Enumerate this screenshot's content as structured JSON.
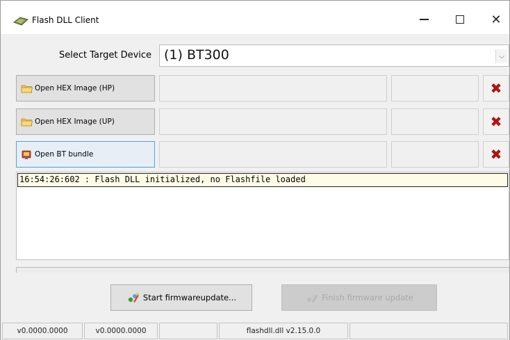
{
  "window": {
    "title": "Flash DLL Client",
    "icon": "flash-chip-icon",
    "controls": {
      "minimize_icon": "minimize-icon",
      "maximize_icon": "maximize-icon",
      "close_symbol": "✕"
    }
  },
  "target": {
    "label": "Select Target Device",
    "selected": "(1) BT300",
    "arrow": "⌵"
  },
  "file_rows": [
    {
      "button_label": "Open HEX Image (HP)",
      "icon": "folder-icon",
      "path": "",
      "info": "",
      "clear_symbol": "✖"
    },
    {
      "button_label": "Open HEX Image (UP)",
      "icon": "folder-icon",
      "path": "",
      "info": "",
      "clear_symbol": "✖"
    },
    {
      "button_label": "Open BT bundle",
      "icon": "bundle-icon",
      "path": "",
      "info": "",
      "clear_symbol": "✖"
    }
  ],
  "log": {
    "lines": [
      "16:54:26:602 : Flash DLL initialized, no Flashfile loaded"
    ]
  },
  "progress": {
    "value": 0
  },
  "actions": {
    "start_label": "Start firmwareupdate...",
    "finish_label": "Finish firmware update"
  },
  "status": {
    "cells": [
      "v0.0000.0000",
      "v0.0000.0000",
      "",
      "flashdll.dll v2.15.0.0",
      ""
    ]
  },
  "colors": {
    "clear_x": "#b21212",
    "focus_border": "#4aa3f0",
    "log_highlight": "#fffbe6"
  }
}
